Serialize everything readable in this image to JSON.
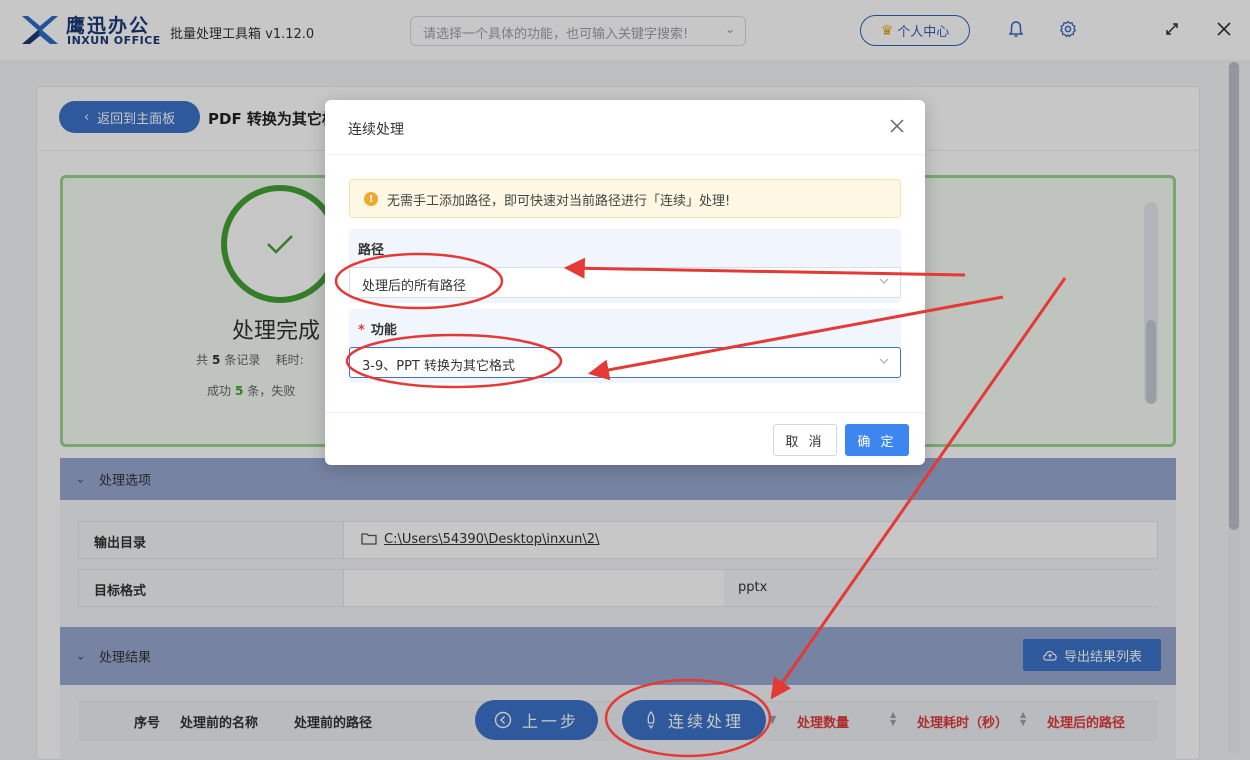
{
  "titlebar": {
    "logo_cn": "鹰迅办公",
    "logo_en": "INXUN OFFICE",
    "app_title": "批量处理工具箱 v1.12.0",
    "search_placeholder": "请选择一个具体的功能，也可输入关键字搜索!",
    "personal_center": "个人中心"
  },
  "page": {
    "back_label": "返回到主面板",
    "title": "PDF 转换为其它格式"
  },
  "summary": {
    "done_text": "处理完成",
    "total_prefix": "共",
    "total": "5",
    "total_suffix": "条记录",
    "elapsed_prefix": "耗时:",
    "success_prefix": "成功",
    "success": "5",
    "success_suffix": "条，失败"
  },
  "options": {
    "header": "处理选项",
    "output_dir_label": "输出目录",
    "output_dir_value": "C:\\Users\\54390\\Desktop\\inxun\\2\\",
    "target_format_label": "目标格式",
    "target_format_value": "pptx"
  },
  "results": {
    "header": "处理结果",
    "export_label": "导出结果列表",
    "columns": [
      "序号",
      "处理前的名称",
      "处理前的路径",
      "处理数量",
      "处理耗时（秒）",
      "处理后的路径"
    ]
  },
  "bottom": {
    "prev_label": "上一步",
    "continue_label": "连续处理"
  },
  "dialog": {
    "title": "连续处理",
    "notice": "无需手工添加路径，即可快速对当前路径进行「连续」处理!",
    "path_label": "路径",
    "path_value": "处理后的所有路径",
    "function_label": "功能",
    "required_mark": "*",
    "function_value": "3-9、PPT 转换为其它格式",
    "cancel": "取 消",
    "ok": "确 定"
  },
  "colors": {
    "brand": "#3d72c9",
    "success": "#45a035",
    "annotation": "#e53935"
  }
}
